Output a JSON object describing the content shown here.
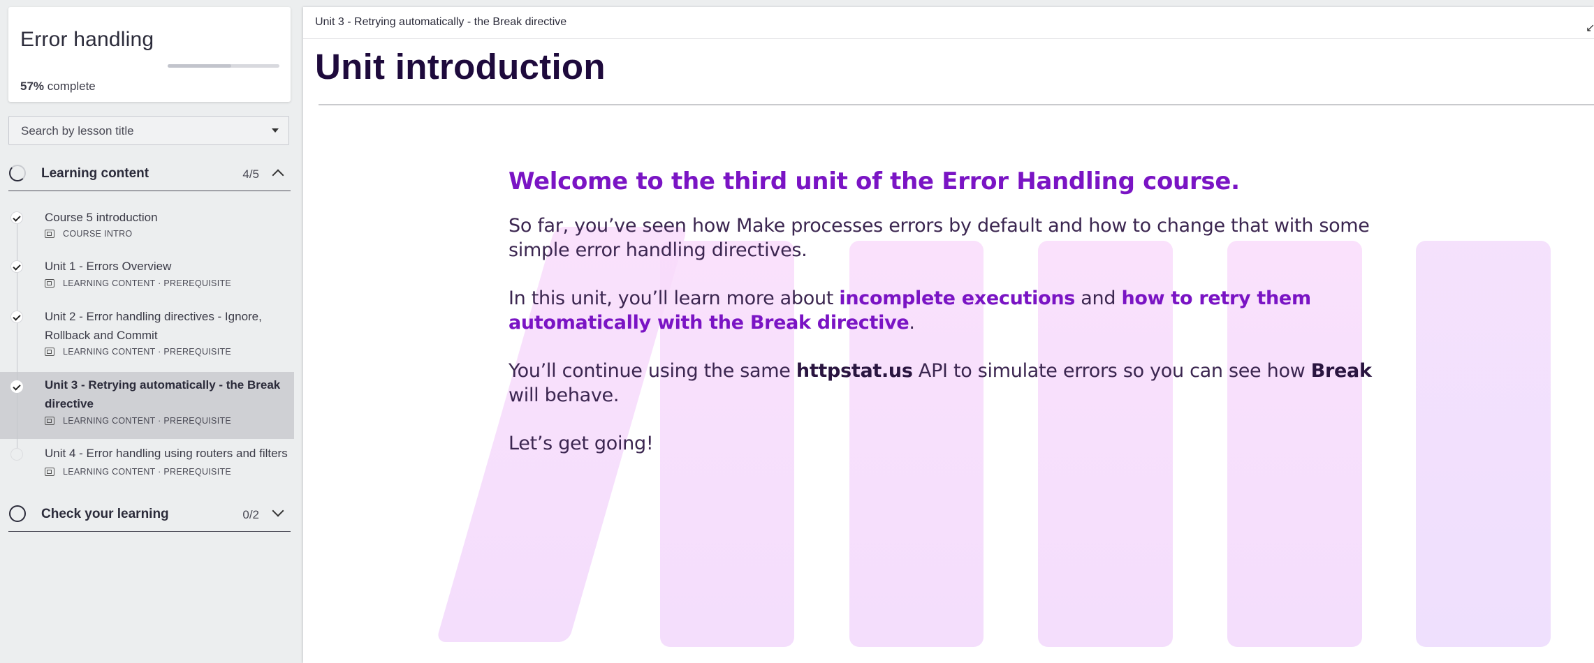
{
  "sidebar": {
    "course_title": "Error handling",
    "progress_value": "57%",
    "progress_suffix": "complete",
    "progress_fraction": 0.57,
    "search_placeholder": "Search by lesson title",
    "sections": [
      {
        "label": "Learning content",
        "count": "4/5",
        "expanded": true
      },
      {
        "label": "Check your learning",
        "count": "0/2",
        "expanded": false
      }
    ],
    "lessons": [
      {
        "title": "Course 5 introduction",
        "meta": "COURSE INTRO",
        "done": true,
        "active": false
      },
      {
        "title": "Unit 1 - Errors Overview",
        "meta": "LEARNING CONTENT · PREREQUISITE",
        "done": true,
        "active": false
      },
      {
        "title": "Unit 2 - Error handling directives - Ignore, Rollback and Commit",
        "meta": "LEARNING CONTENT · PREREQUISITE",
        "done": true,
        "active": false
      },
      {
        "title": "Unit 3 - Retrying automatically - the Break directive",
        "meta": "LEARNING CONTENT · PREREQUISITE",
        "done": true,
        "active": true
      },
      {
        "title": "Unit 4 - Error handling using routers and filters",
        "meta": "LEARNING CONTENT · PREREQUISITE",
        "done": false,
        "active": false
      }
    ]
  },
  "main": {
    "breadcrumb": "Unit 3 - Retrying automatically - the Break directive",
    "title": "Unit introduction",
    "welcome": "Welcome to the third unit of the Error Handling course.",
    "p1": "So far, you’ve seen how Make processes errors by default and how to change that with some simple error handling directives.",
    "p2_a": "In this unit, you’ll learn more about ",
    "p2_b": "incomplete executions",
    "p2_c": " and ",
    "p2_d": "how to retry them automatically with the Break directive",
    "p2_e": ".",
    "p3_a": "You’ll continue using the same ",
    "p3_b": "httpstat.us",
    "p3_c": " API to simulate errors so you can see how ",
    "p3_d": "Break",
    "p3_e": " will behave.",
    "p4": "Let’s get going!"
  },
  "colors": {
    "accent": "#7a14c4",
    "title": "#1e0a3c",
    "deco": "#f9dcfb"
  },
  "icons": [
    "check-icon",
    "lesson-type-icon",
    "chevron-up-icon",
    "chevron-down-icon",
    "collapse-icon",
    "dropdown-caret-icon"
  ]
}
